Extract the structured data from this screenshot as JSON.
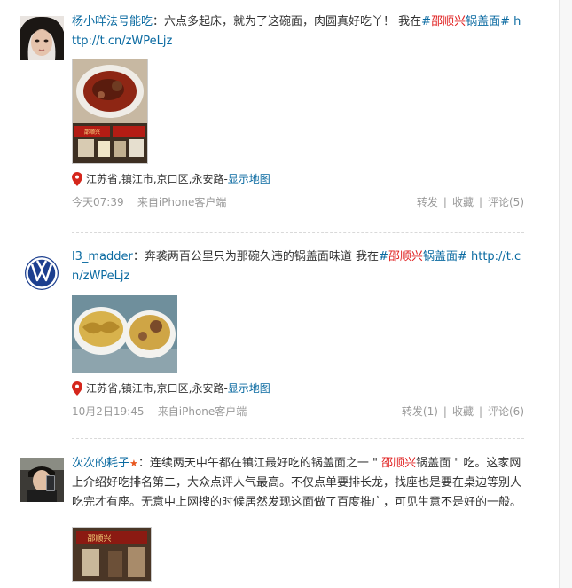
{
  "posts": [
    {
      "user": "杨小咩法号能吃",
      "colon": "：",
      "text_before": "六点多起床，就为了这碗面，肉圆真好吃丫！ 我在",
      "topic_open": "#",
      "topic_red": "邵顺兴",
      "topic_rest": "锅盖面#",
      "link": "http://t.cn/zWPeLjz",
      "location": "江苏省,镇江市,京口区,永安路",
      "map_sep": " - ",
      "map_label": "显示地图",
      "time": "今天07:39",
      "source": "来自iPhone客户端",
      "repost": "转发",
      "favorite": "收藏",
      "comment": "评论(5)"
    },
    {
      "user": "l3_madder",
      "colon": "：",
      "text_before": "奔袭两百公里只为那碗久违的锅盖面味道 我在",
      "topic_open": "#",
      "topic_red": "邵顺兴",
      "topic_rest": "锅盖面#",
      "link": "http://t.cn/zWPeLjz",
      "location": "江苏省,镇江市,京口区,永安路",
      "map_sep": " - ",
      "map_label": "显示地图",
      "time": "10月2日19:45",
      "source": "来自iPhone客户端",
      "repost": "转发(1)",
      "favorite": "收藏",
      "comment": "评论(6)"
    },
    {
      "user": "次次的耗子",
      "colon": "：",
      "text_before": "连续两天中午都在镇江最好吃的锅盖面之一 \" ",
      "name_red": "邵顺兴",
      "text_after": "锅盖面 \" 吃。这家网上介绍好吃排名第二，大众点评人气最高。不仅点单要排长龙，找座也是要在桌边等别人吃完才有座。无意中上网搜的时候居然发现这面做了百度推广，可见生意不是好的一般。",
      "sign_text": "邵顺兴"
    }
  ],
  "separator": "|",
  "colors": {
    "link": "#0a6aa1",
    "highlight": "#e02020",
    "meta": "#999999"
  }
}
